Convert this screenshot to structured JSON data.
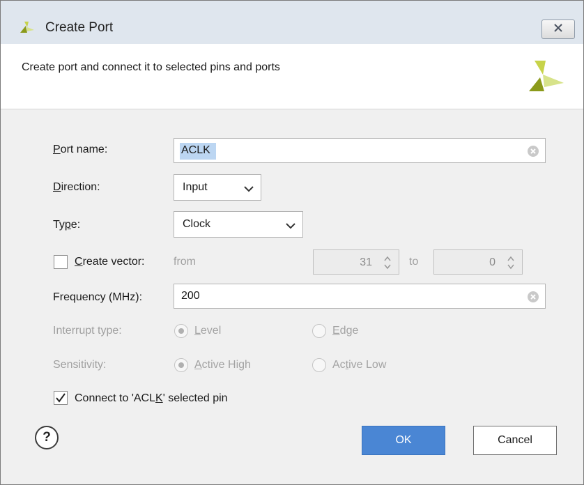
{
  "window": {
    "title": "Create Port",
    "description": "Create port and connect it to selected pins and ports"
  },
  "form": {
    "port_name": {
      "label_prefix": "",
      "label_access_key": "P",
      "label_rest": "ort name:",
      "value": "ACLK"
    },
    "direction": {
      "label_access_key": "D",
      "label_rest": "irection:",
      "value": "Input"
    },
    "type": {
      "label_start": "Ty",
      "label_access_key": "p",
      "label_rest": "e:",
      "value": "Clock"
    },
    "create_vector": {
      "label_access_key": "C",
      "label_rest": "reate vector:",
      "checked": false,
      "from_label": "from",
      "from_value": "31",
      "to_label": "to",
      "to_value": "0"
    },
    "frequency": {
      "label": "Frequency (MHz):",
      "value": "200"
    },
    "interrupt_type": {
      "label": "Interrupt type:",
      "options": [
        {
          "access_key": "L",
          "rest": "evel",
          "selected": true
        },
        {
          "access_key": "E",
          "rest": "dge",
          "selected": false
        }
      ]
    },
    "sensitivity": {
      "label": "Sensitivity:",
      "options": [
        {
          "access_key": "A",
          "rest": "ctive High",
          "selected": true
        },
        {
          "start": "Ac",
          "access_key": "t",
          "rest": "ive Low",
          "selected": false
        }
      ]
    },
    "connect": {
      "checked": true,
      "label_start": "Connect to 'ACL",
      "label_access_key": "K",
      "label_rest": "' selected  pin"
    }
  },
  "buttons": {
    "help": "?",
    "ok": "OK",
    "cancel": "Cancel"
  },
  "colors": {
    "accent": "#4a86d4",
    "logo_dark": "#8b9a1a",
    "logo_light": "#d7e38a"
  }
}
